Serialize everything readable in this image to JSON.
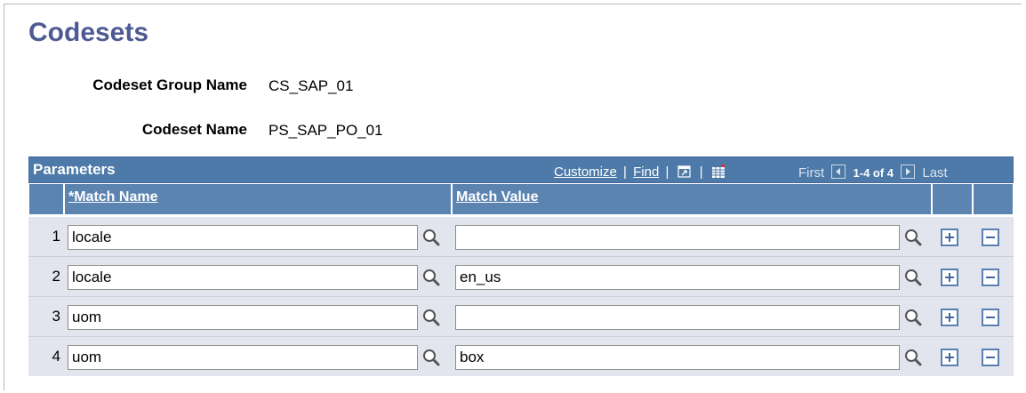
{
  "page": {
    "title": "Codesets"
  },
  "fields": {
    "group_label": "Codeset Group Name",
    "group_value": "CS_SAP_01",
    "codeset_label": "Codeset Name",
    "codeset_value": "PS_SAP_PO_01"
  },
  "grid": {
    "title": "Parameters",
    "tools": {
      "customize": "Customize",
      "find": "Find",
      "separator": "|"
    },
    "nav": {
      "first": "First",
      "count": "1-4 of 4",
      "last": "Last"
    },
    "columns": {
      "match_name": "*Match Name",
      "match_value": "Match Value"
    },
    "rows": [
      {
        "num": "1",
        "match_name": "locale",
        "match_value": ""
      },
      {
        "num": "2",
        "match_name": "locale",
        "match_value": "en_us"
      },
      {
        "num": "3",
        "match_name": "uom",
        "match_value": ""
      },
      {
        "num": "4",
        "match_name": "uom",
        "match_value": "box"
      }
    ]
  },
  "icons": {
    "lookup": "magnifier-icon",
    "add": "plus-icon",
    "delete": "minus-icon",
    "view_all": "zoom-window-icon",
    "download": "spreadsheet-icon",
    "prev": "arrow-left-icon",
    "next": "arrow-right-icon"
  },
  "colors": {
    "title": "#4e5a93",
    "grid_header": "#4d7aa8",
    "row_bg": "#e2e5ee"
  }
}
